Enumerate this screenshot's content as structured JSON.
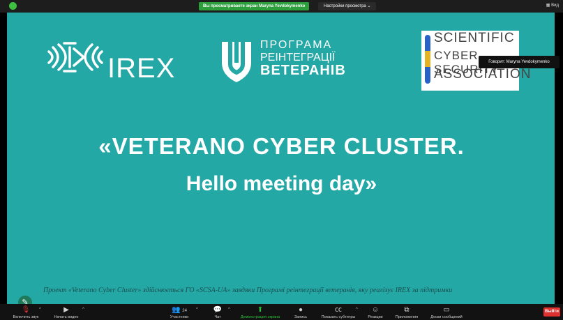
{
  "top_bar": {
    "share_notice": "Вы просматриваете экран Maryna Yevdokymenko",
    "view_settings": "Настройки просмотра",
    "view_button": "Вид"
  },
  "slide": {
    "irex_logo_text": "IREX",
    "veteran_logo": {
      "line1": "ПРОГРАМА",
      "line2": "РЕІНТЕГРАЦІЇ",
      "line3": "ВЕТЕРАНІВ"
    },
    "scsa_logo": {
      "line1": "SCIENTIFIC",
      "line2": "CYBER SECURITY",
      "line3": "ASSOCIATION"
    },
    "title_line1": "«VETERANO  CYBER  CLUSTER.",
    "title_line2": "Hello  meeting day»",
    "footer_text": "Проект «Veterano Cyber Cluster» здійснюється ГО «SCSA-UA»  завдяки Програмі реінтеграції ветеранів, яку реалізує IREX за підтримки"
  },
  "speaker_tooltip": "Говорит: Maryna Yevdokymenko",
  "toolbar": {
    "audio": "Включить звук",
    "video": "Начать видео",
    "participants": "Участники",
    "participants_count": "24",
    "chat": "Чат",
    "share_screen": "Демонстрация экрана",
    "record": "Запись",
    "captions": "Показать субтитры",
    "reactions": "Реакции",
    "apps": "Приложения",
    "whiteboards": "Доски сообщений",
    "leave": "Выйти"
  },
  "colors": {
    "slide_background": "#24a8a6",
    "share_notice_bg": "#2d9e3c",
    "leave_button": "#e03131"
  }
}
